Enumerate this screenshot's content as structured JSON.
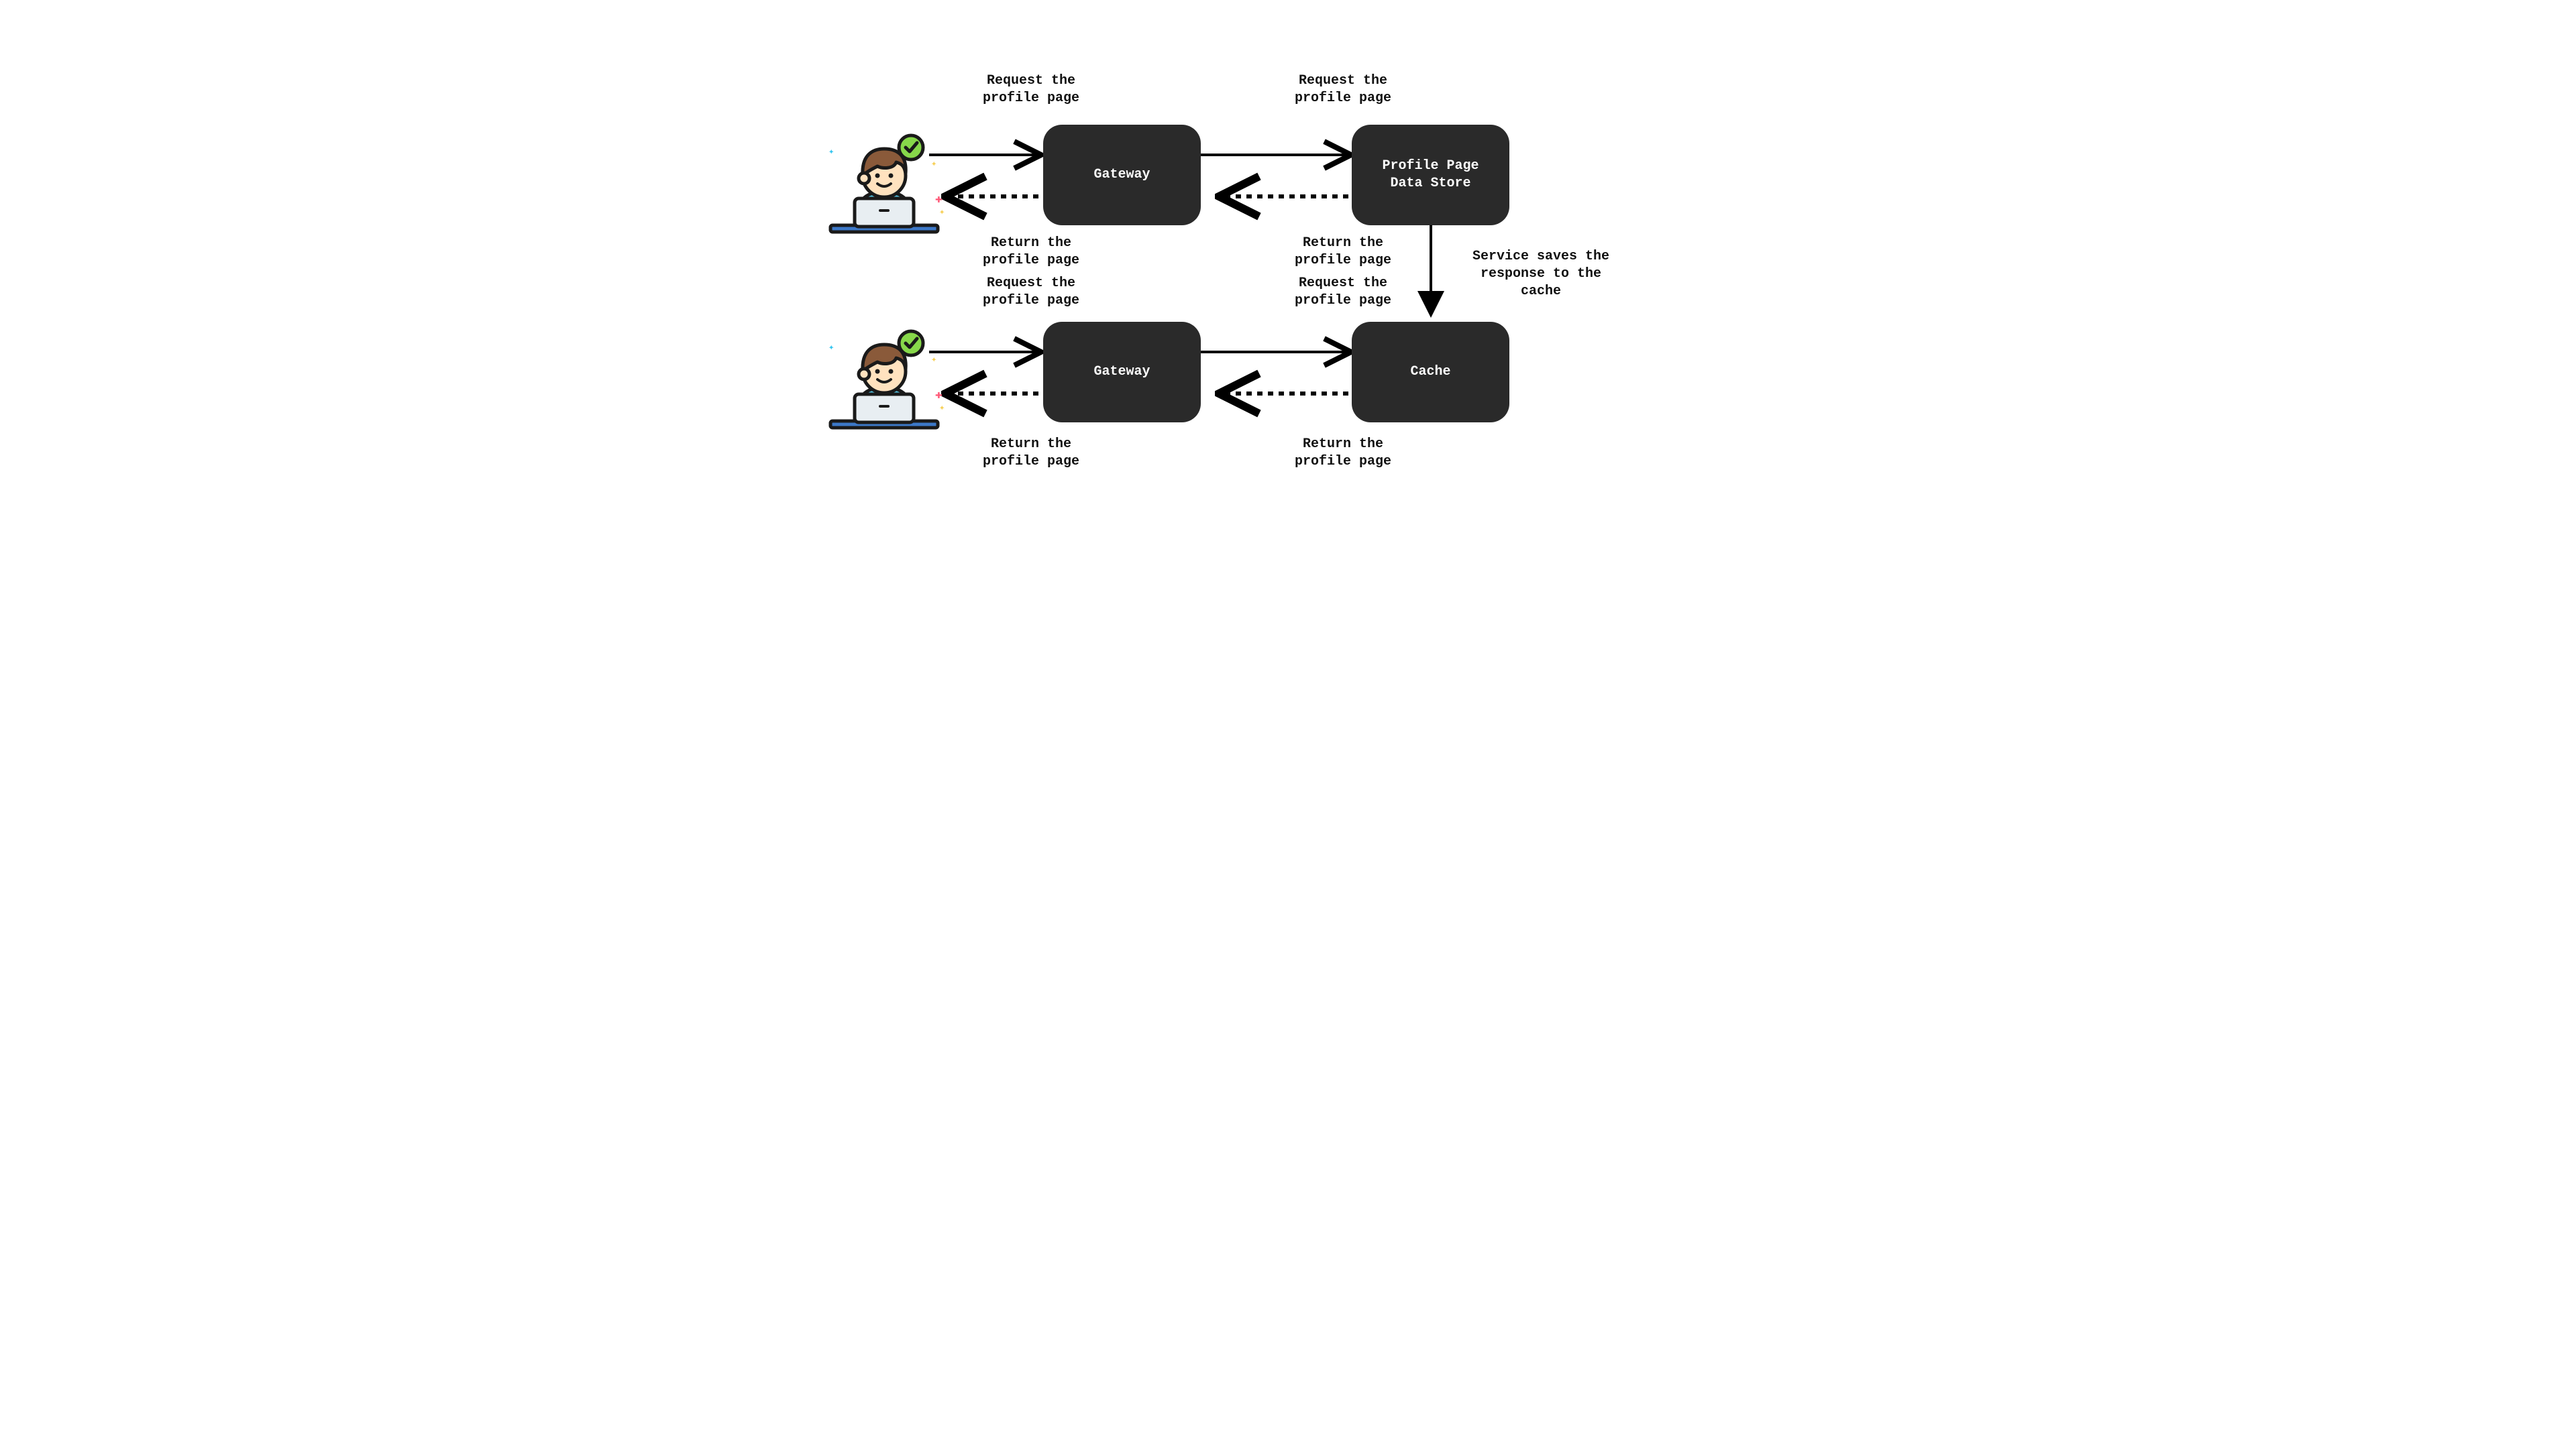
{
  "nodes": {
    "gateway1": "Gateway",
    "datastore": "Profile Page\nData Store",
    "gateway2": "Gateway",
    "cache": "Cache"
  },
  "labels": {
    "req1a": "Request the\nprofile page",
    "req1b": "Request the\nprofile page",
    "ret1a": "Return the\nprofile page",
    "ret1b": "Return the\nprofile page",
    "req2a": "Request the\nprofile page",
    "req2b": "Request the\nprofile page",
    "ret2a": "Return the\nprofile page",
    "ret2b": "Return the\nprofile page",
    "savecache": "Service saves the\nresponse to the\ncache"
  },
  "actors": {
    "user1": "user-at-laptop",
    "user2": "user-at-laptop"
  }
}
